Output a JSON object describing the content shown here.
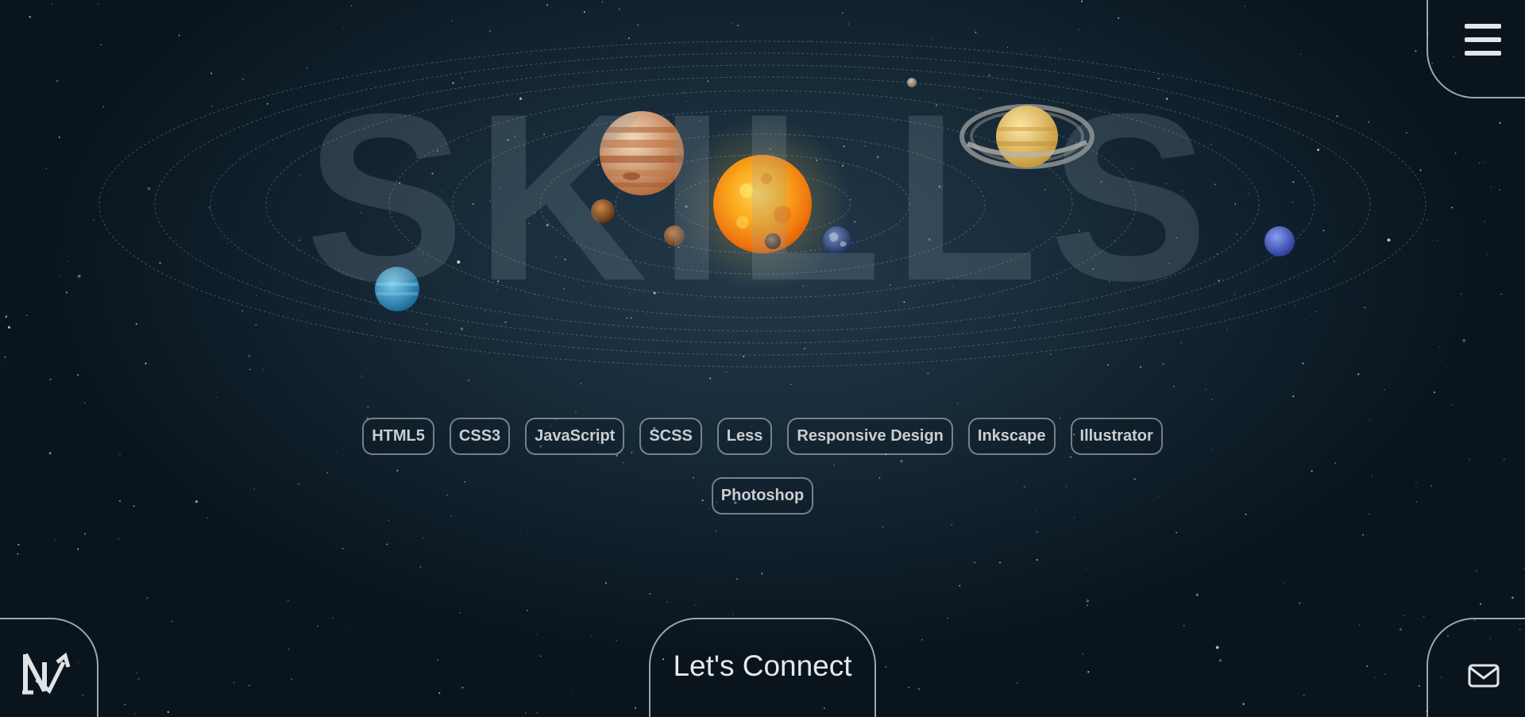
{
  "page": {
    "title": "SKILLS"
  },
  "skills": [
    "HTML5",
    "CSS3",
    "JavaScript",
    "SCSS",
    "Less",
    "Responsive Design",
    "Inkscape",
    "Illustrator",
    "Photoshop"
  ],
  "nav": {
    "menu_icon": "hamburger-menu-icon",
    "logo_icon": "logo-monogram-icon",
    "mail_icon": "envelope-icon",
    "connect_label": "Let's Connect"
  },
  "solar_system": {
    "sun": "sun",
    "planets": [
      "mercury",
      "venus",
      "earth",
      "mars",
      "jupiter",
      "saturn",
      "uranus",
      "neptune",
      "pluto"
    ],
    "orbit_count": 9
  },
  "colors": {
    "background": "#0e1c27",
    "pill_border": "#c8d2d7",
    "pill_text": "#c9ced2",
    "title_overlay": "#8ca0af",
    "sun": "#f59a16"
  }
}
